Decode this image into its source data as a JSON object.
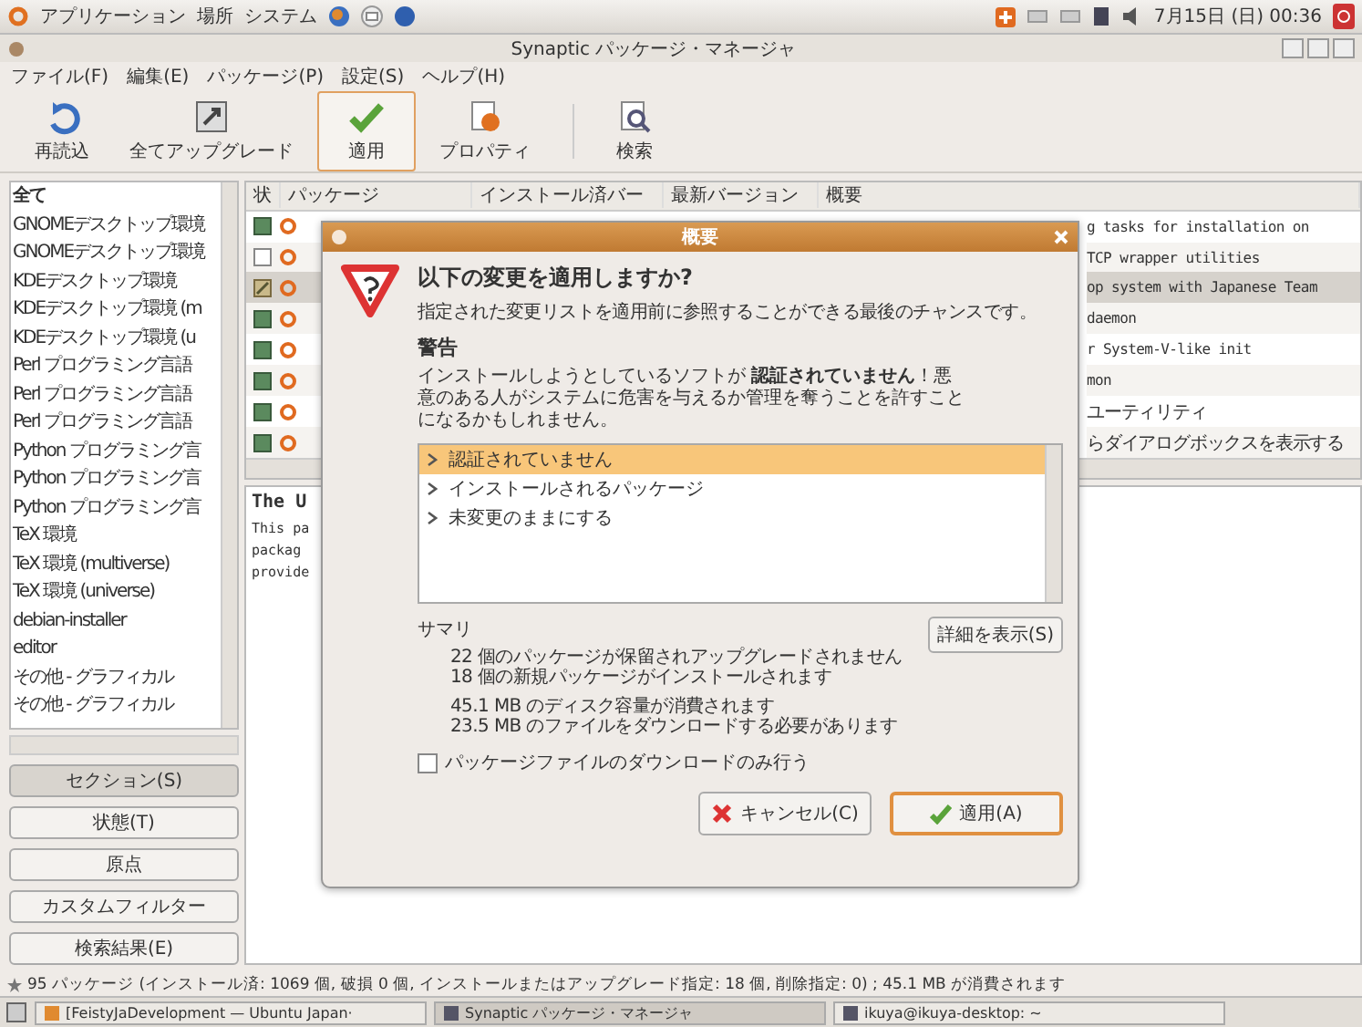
{
  "top_panel": {
    "menus": [
      "アプリケーション",
      "場所",
      "システム"
    ],
    "clock": "7月15日 (日) 00:36"
  },
  "window": {
    "title": "Synaptic パッケージ・マネージャ"
  },
  "menu_bar": [
    "ファイル(F)",
    "編集(E)",
    "パッケージ(P)",
    "設定(S)",
    "ヘルプ(H)"
  ],
  "toolbar": [
    {
      "kind": "reload",
      "label": "再読込",
      "selected": false
    },
    {
      "kind": "upgrade",
      "label": "全てアップグレード",
      "selected": false
    },
    {
      "kind": "apply",
      "label": "適用",
      "selected": true
    },
    {
      "kind": "properties",
      "label": "プロパティ",
      "selected": false
    },
    {
      "kind": "search",
      "label": "検索",
      "selected": false
    }
  ],
  "sidebar": {
    "items": [
      {
        "label": "全て",
        "selected": true
      },
      {
        "label": "GNOMEデスクトップ環境",
        "selected": false
      },
      {
        "label": "GNOMEデスクトップ環境",
        "selected": false
      },
      {
        "label": "KDEデスクトップ環境",
        "selected": false
      },
      {
        "label": "KDEデスクトップ環境 (m",
        "selected": false
      },
      {
        "label": "KDEデスクトップ環境 (u",
        "selected": false
      },
      {
        "label": "Perl プログラミング言語",
        "selected": false
      },
      {
        "label": "Perl プログラミング言語",
        "selected": false
      },
      {
        "label": "Perl プログラミング言語",
        "selected": false
      },
      {
        "label": "Python プログラミング言",
        "selected": false
      },
      {
        "label": "Python プログラミング言",
        "selected": false
      },
      {
        "label": "Python プログラミング言",
        "selected": false
      },
      {
        "label": "TeX 環境",
        "selected": false
      },
      {
        "label": "TeX 環境 (multiverse)",
        "selected": false
      },
      {
        "label": "TeX 環境 (universe)",
        "selected": false
      },
      {
        "label": "debian-installer",
        "selected": false
      },
      {
        "label": "editor",
        "selected": false
      },
      {
        "label": "その他 - グラフィカル",
        "selected": false
      },
      {
        "label": "その他 - グラフィカル",
        "selected": false
      }
    ],
    "filters": [
      {
        "label": "セクション(S)",
        "selected": true
      },
      {
        "label": "状態(T)",
        "selected": false
      },
      {
        "label": "原点",
        "selected": false
      },
      {
        "label": "カスタムフィルター",
        "selected": false
      },
      {
        "label": "検索結果(E)",
        "selected": false
      }
    ]
  },
  "table": {
    "columns": [
      "状",
      "パッケージ",
      "インストール済バー",
      "最新バージョン",
      "概要"
    ],
    "rows": [
      {
        "kind": "installed",
        "summary": "g tasks for installation on",
        "selected": false
      },
      {
        "kind": "not-installed",
        "summary": "TCP wrapper utilities",
        "selected": false
      },
      {
        "kind": "upgrade",
        "summary": "op system with Japanese Team",
        "selected": true
      },
      {
        "kind": "installed",
        "summary": "daemon",
        "selected": false
      },
      {
        "kind": "installed",
        "summary": "r System-V-like init",
        "selected": false
      },
      {
        "kind": "installed",
        "summary": "mon",
        "selected": false
      },
      {
        "kind": "installed",
        "summary": "ユーティリティ",
        "selected": false
      },
      {
        "kind": "installed",
        "summary": "らダイアログボックスを表示する",
        "selected": false
      }
    ]
  },
  "description": {
    "title": "The U",
    "lines": [
      "This pa",
      "packag",
      "provide"
    ]
  },
  "dialog": {
    "title": "概要",
    "heading": "以下の変更を適用しますか?",
    "subtitle": "指定された変更リストを適用前に参照することができる最後のチャンスです。",
    "warning_title": "警告",
    "warning": "インストールしようとしているソフトが **認証されていません**！悪意のある人がシステムに危害を与えるか管理を奪うことを許すことになるかもしれません。",
    "tree": [
      {
        "label": "認証されていません",
        "selected": true
      },
      {
        "label": "インストールされるパッケージ",
        "selected": false
      },
      {
        "label": "未変更のままにする",
        "selected": false
      }
    ],
    "summary_title": "サマリ",
    "details_button": "詳細を表示(S)",
    "summary_lines": [
      [
        "22 個のパッケージが保留されアップグレードされません",
        "18 個の新規パッケージがインストールされます"
      ],
      [
        "45.1 MB のディスク容量が消費されます",
        "23.5 MB のファイルをダウンロードする必要があります"
      ]
    ],
    "download_only": {
      "label": "パッケージファイルのダウンロードのみ行う",
      "checked": false
    },
    "buttons": [
      {
        "kind": "cancel",
        "label": "キャンセル(C)"
      },
      {
        "kind": "apply",
        "label": "適用(A)"
      }
    ]
  },
  "status_bar": "95 パッケージ (インストール済: 1069 個, 破損 0 個, インストールまたはアップグレード指定: 18 個, 削除指定: 0) ; 45.1 MB が消費されます",
  "taskbar": [
    {
      "label": "[FeistyJaDevelopment — Ubuntu Japan·",
      "selected": false
    },
    {
      "label": "Synaptic パッケージ・マネージャ",
      "selected": true
    },
    {
      "label": "ikuya@ikuya-desktop: ~",
      "selected": false
    }
  ]
}
